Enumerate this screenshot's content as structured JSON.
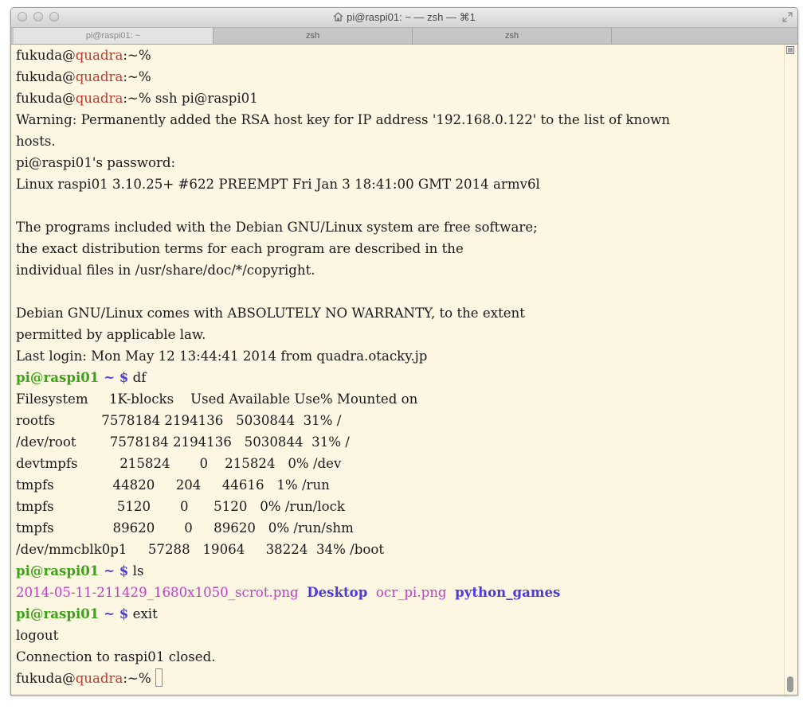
{
  "window": {
    "title": "pi@raspi01: ~ — zsh — ⌘1"
  },
  "tabs": [
    {
      "label": "pi@raspi01: ~",
      "active": true
    },
    {
      "label": "zsh",
      "active": false
    },
    {
      "label": "zsh",
      "active": false
    }
  ],
  "terminal": {
    "local_user": "fukuda",
    "at": "@",
    "local_host": "quadra",
    "local_suffix": ":~%",
    "remote_prompt": "pi@raspi01",
    "remote_prompt_tail": " ~ $",
    "cmd_ssh": " ssh pi@raspi01",
    "warning1": "Warning: Permanently added the RSA host key for IP address '192.168.0.122' to the list of known",
    "warning2": "hosts.",
    "password": "pi@raspi01's password:",
    "uname": "Linux raspi01 3.10.25+ #622 PREEMPT Fri Jan 3 18:41:00 GMT 2014 armv6l",
    "motd1": "The programs included with the Debian GNU/Linux system are free software;",
    "motd2": "the exact distribution terms for each program are described in the",
    "motd3": "individual files in /usr/share/doc/*/copyright.",
    "motd4": "Debian GNU/Linux comes with ABSOLUTELY NO WARRANTY, to the extent",
    "motd5": "permitted by applicable law.",
    "lastlogin": "Last login: Mon May 12 13:44:41 2014 from quadra.otacky.jp",
    "cmd_df": " df",
    "df_header": "Filesystem     1K-blocks    Used Available Use% Mounted on",
    "df_rows": [
      "rootfs           7578184 2194136   5030844  31% /",
      "/dev/root        7578184 2194136   5030844  31% /",
      "devtmpfs          215824       0    215824   0% /dev",
      "tmpfs              44820     204     44616   1% /run",
      "tmpfs               5120       0      5120   0% /run/lock",
      "tmpfs              89620       0     89620   0% /run/shm",
      "/dev/mmcblk0p1     57288   19064     38224  34% /boot"
    ],
    "cmd_ls": " ls",
    "ls_file1": "2014-05-11-211429_1680x1050_scrot.png",
    "ls_dir1": "Desktop",
    "ls_file2": "ocr_pi.png",
    "ls_dir2": "python_games",
    "cmd_exit": " exit",
    "logout": "logout",
    "closed": "Connection to raspi01 closed."
  },
  "colors": {
    "host": "#c0392b",
    "prompt_green": "#3ba316",
    "prompt_blue": "#4a3adf",
    "file_magenta": "#c13fc6",
    "background": "#fdf6e3"
  },
  "icons": [
    "home-icon",
    "fullscreen-icon",
    "terminal-menu-icon"
  ]
}
